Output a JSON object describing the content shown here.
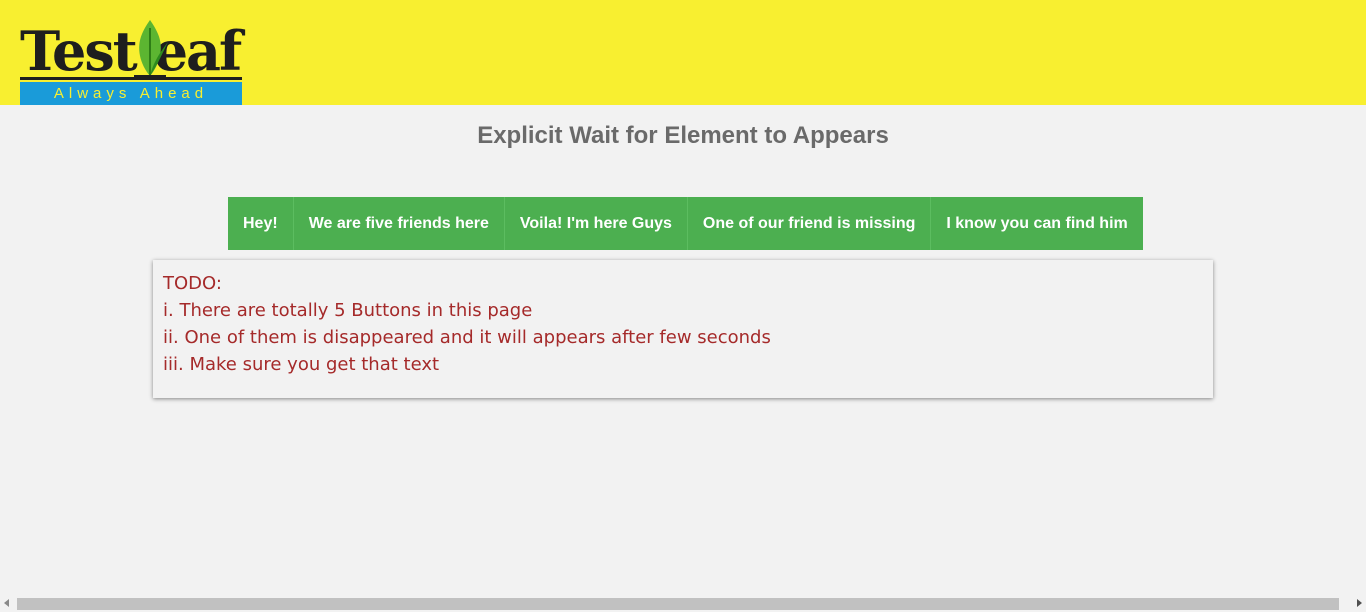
{
  "header": {
    "logo": {
      "wordmark": "TestLeaf",
      "tagline": "Always Ahead"
    },
    "background_color": "#f8ef30"
  },
  "page": {
    "title": "Explicit Wait for Element to Appears"
  },
  "buttons": [
    {
      "label": "Hey!"
    },
    {
      "label": "We are five friends here"
    },
    {
      "label": "Voila! I'm here Guys"
    },
    {
      "label": "One of our friend is missing"
    },
    {
      "label": "I know you can find him"
    }
  ],
  "button_color": "#4caf50",
  "todo": {
    "heading": "TODO:",
    "items": [
      "i. There are totally 5 Buttons in this page",
      "ii. One of them is disappeared and it will appears after few seconds",
      "iii. Make sure you get that text"
    ],
    "text_color": "#a52a2a"
  }
}
